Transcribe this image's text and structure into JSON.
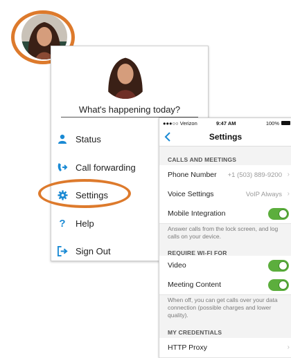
{
  "menu": {
    "prompt": "What's happening today?",
    "items": [
      {
        "label": "Status",
        "icon": "person-icon"
      },
      {
        "label": "Call forwarding",
        "icon": "call-forward-icon"
      },
      {
        "label": "Settings",
        "icon": "gear-icon"
      },
      {
        "label": "Help",
        "icon": "question-icon"
      },
      {
        "label": "Sign Out",
        "icon": "sign-out-icon"
      }
    ]
  },
  "phone": {
    "status": {
      "carrier": "●●●○○ Verizon",
      "time": "9:47 AM",
      "battery": "100%"
    },
    "title": "Settings",
    "sections": {
      "calls": "CALLS AND MEETINGS",
      "wifi": "REQUIRE WI-FI FOR",
      "credentials": "MY CREDENTIALS"
    },
    "rows": {
      "phone_number": {
        "label": "Phone Number",
        "value": "+1 (503) 889-9200"
      },
      "voice_settings": {
        "label": "Voice Settings",
        "value": "VoIP Always"
      },
      "mobile_integration": {
        "label": "Mobile Integration",
        "on": true
      },
      "video": {
        "label": "Video",
        "on": true
      },
      "meeting_content": {
        "label": "Meeting Content",
        "on": true
      },
      "http_proxy": {
        "label": "HTTP Proxy"
      }
    },
    "notes": {
      "mobile": "Answer calls from the lock screen, and log calls on your device.",
      "wifi": "When off, you can get calls over your data connection (possible charges and lower quality)."
    }
  },
  "colors": {
    "accent": "#1a8ad4",
    "highlight": "#dd7a2c",
    "toggle_on": "#5cae3d"
  }
}
